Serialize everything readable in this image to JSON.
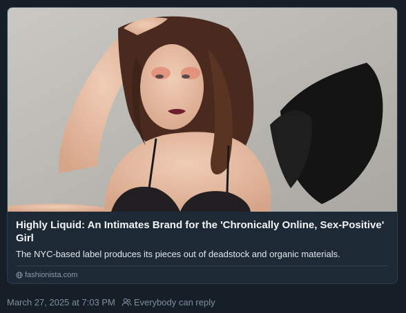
{
  "link_card": {
    "title": "Highly Liquid: An Intimates Brand for the 'Chronically Online, Sex-Positive' Girl",
    "description": "The NYC-based label produces its pieces out of deadstock and organic materials.",
    "source": "fashionista.com",
    "source_icon": "globe-icon"
  },
  "post_meta": {
    "timestamp": "March 27, 2025 at 7:03 PM",
    "reply_setting": "Everybody can reply",
    "reply_icon": "people-icon"
  },
  "colors": {
    "background": "#161e27",
    "card": "#1e2936",
    "card_border": "#2e3c4c",
    "muted_text": "#7f8fa0"
  }
}
